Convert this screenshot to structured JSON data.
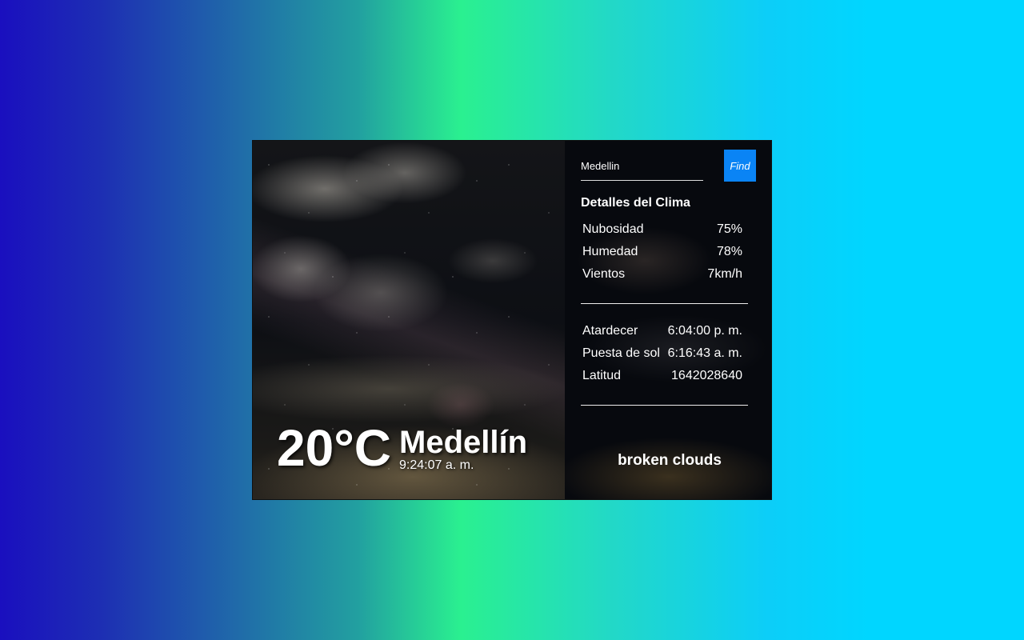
{
  "current": {
    "temperature": "20°C",
    "city": "Medellín",
    "time": "9:24:07 a. m."
  },
  "search": {
    "value": "Medellin",
    "button_label": "Find"
  },
  "details": {
    "title": "Detalles del Clima",
    "group1": [
      {
        "label": "Nubosidad",
        "value": "75%"
      },
      {
        "label": "Humedad",
        "value": "78%"
      },
      {
        "label": "Vientos",
        "value": "7km/h"
      }
    ],
    "group2": [
      {
        "label": "Atardecer",
        "value": "6:04:00 p. m."
      },
      {
        "label": "Puesta de sol",
        "value": "6:16:43 a. m."
      },
      {
        "label": "Latitud",
        "value": "1642028640"
      }
    ],
    "description": "broken clouds"
  },
  "colors": {
    "find_button": "#0a84f5"
  }
}
